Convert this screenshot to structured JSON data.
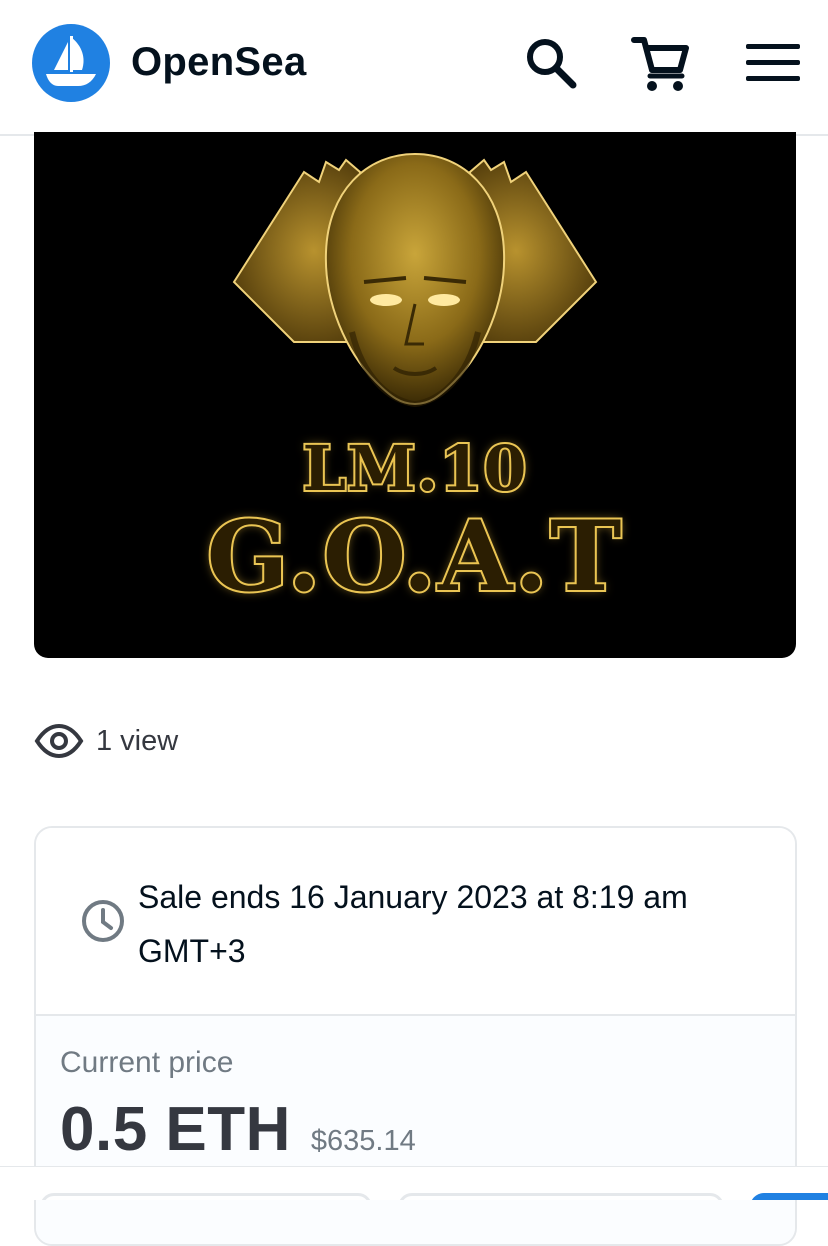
{
  "header": {
    "brand_name": "OpenSea",
    "logo_icon": "opensea-boat-logo",
    "search_icon": "search-icon",
    "cart_icon": "cart-icon",
    "menu_icon": "hamburger-menu-icon"
  },
  "artwork": {
    "line1": "LM.10",
    "line2": "G.O.A.T"
  },
  "stats": {
    "views_label": "1 view"
  },
  "listing": {
    "sale_text": "Sale ends 16 January 2023 at 8:19 am GMT+3",
    "current_price_label": "Current price",
    "price_eth": "0.5 ETH",
    "price_usd": "$635.14"
  },
  "colors": {
    "brand_blue": "#2081e2",
    "text_dark": "#04111d",
    "text_muted": "#707a83",
    "border": "#e5e8eb",
    "gold": "#e9c75a"
  }
}
